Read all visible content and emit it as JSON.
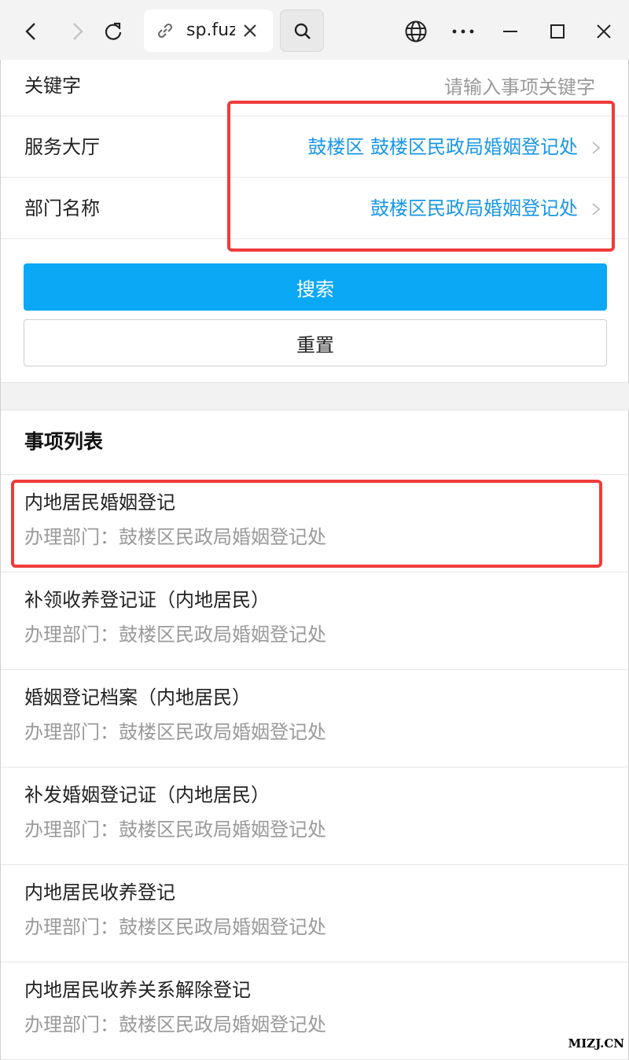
{
  "browser": {
    "tab_title": "sp.fuz",
    "icons": [
      "back-icon",
      "forward-icon",
      "reload-icon",
      "link-icon",
      "close-icon",
      "search-icon",
      "globe-icon",
      "more-icon",
      "minimize-icon",
      "maximize-icon",
      "window-close-icon"
    ]
  },
  "form": {
    "keyword_label": "关键字",
    "keyword_placeholder": "请输入事项关键字",
    "hall_label": "服务大厅",
    "hall_value": "鼓楼区 鼓楼区民政局婚姻登记处",
    "dept_label": "部门名称",
    "dept_value": "鼓楼区民政局婚姻登记处",
    "search_button": "搜索",
    "reset_button": "重置"
  },
  "list": {
    "title": "事项列表",
    "items": [
      {
        "name": "内地居民婚姻登记",
        "dept": "办理部门：鼓楼区民政局婚姻登记处"
      },
      {
        "name": "补领收养登记证（内地居民）",
        "dept": "办理部门：鼓楼区民政局婚姻登记处"
      },
      {
        "name": "婚姻登记档案（内地居民）",
        "dept": "办理部门：鼓楼区民政局婚姻登记处"
      },
      {
        "name": "补发婚姻登记证（内地居民）",
        "dept": "办理部门：鼓楼区民政局婚姻登记处"
      },
      {
        "name": "内地居民收养登记",
        "dept": "办理部门：鼓楼区民政局婚姻登记处"
      },
      {
        "name": "内地居民收养关系解除登记",
        "dept": "办理部门：鼓楼区民政局婚姻登记处"
      }
    ]
  },
  "watermark": "MIZJ.CN",
  "colors": {
    "accent": "#0aa8f5",
    "link_value": "#1a97e6",
    "highlight": "#ef3b3b"
  }
}
